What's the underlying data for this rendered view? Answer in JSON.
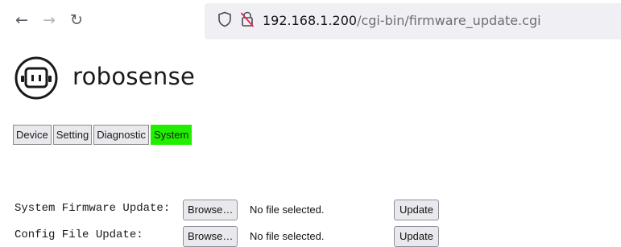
{
  "browser": {
    "url_host": "192.168.1.200",
    "url_path": "/cgi-bin/firmware_update.cgi",
    "back_icon": "arrow-left-icon",
    "forward_icon": "arrow-right-icon",
    "reload_icon": "reload-icon",
    "shield_icon": "shield-icon",
    "insecure_icon": "insecure-lock-icon"
  },
  "brand": {
    "name": "robosense",
    "accent": "#22ee00"
  },
  "tabs": [
    {
      "label": "Device",
      "active": false
    },
    {
      "label": "Setting",
      "active": false
    },
    {
      "label": "Diagnostic",
      "active": false
    },
    {
      "label": "System",
      "active": true
    }
  ],
  "form": {
    "rows": [
      {
        "label": "System Firmware Update:",
        "browse_label": "Browse…",
        "file_status": "No file selected.",
        "update_label": "Update"
      },
      {
        "label": "Config File Update:",
        "browse_label": "Browse…",
        "file_status": "No file selected.",
        "update_label": "Update"
      }
    ]
  }
}
